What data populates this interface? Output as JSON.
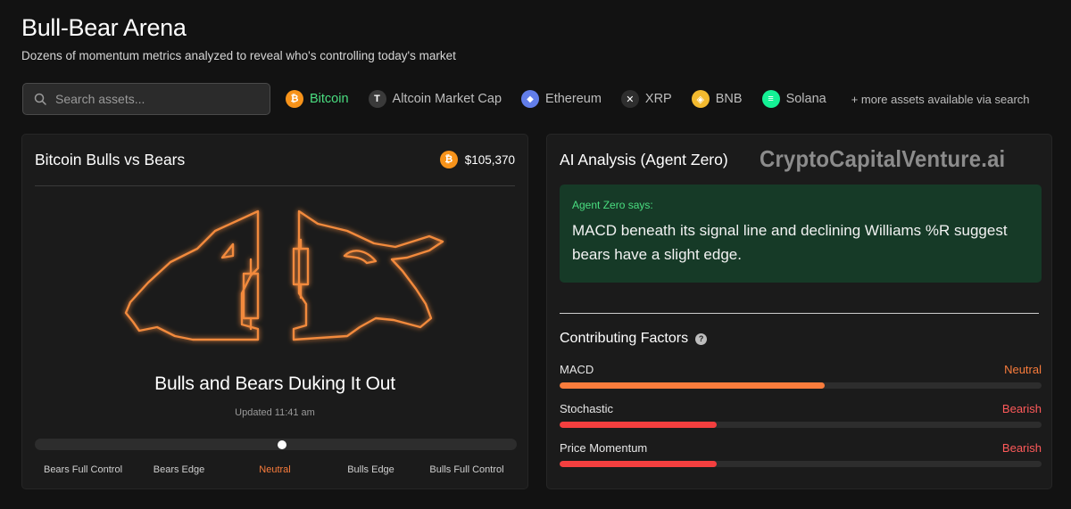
{
  "page": {
    "title": "Bull-Bear Arena",
    "subtitle": "Dozens of momentum metrics analyzed to reveal who's controlling today's market"
  },
  "search": {
    "placeholder": "Search assets..."
  },
  "assets": [
    {
      "label": "Bitcoin",
      "icon": "bitcoin-icon",
      "color": "#f7931a",
      "glyph": "₿",
      "active": true
    },
    {
      "label": "Altcoin Market Cap",
      "icon": "altcoin-icon",
      "color": "#3a3a3a",
      "glyph": "T",
      "active": false
    },
    {
      "label": "Ethereum",
      "icon": "ethereum-icon",
      "color": "#627eea",
      "glyph": "◆",
      "active": false
    },
    {
      "label": "XRP",
      "icon": "xrp-icon",
      "color": "#2e2e2e",
      "glyph": "✕",
      "active": false
    },
    {
      "label": "BNB",
      "icon": "bnb-icon",
      "color": "#f3ba2f",
      "glyph": "◈",
      "active": false
    },
    {
      "label": "Solana",
      "icon": "solana-icon",
      "color": "#14f195",
      "glyph": "≡",
      "active": false
    }
  ],
  "more_assets": "+ more assets available via search",
  "left_card": {
    "title": "Bitcoin Bulls vs Bears",
    "price": "$105,370",
    "verdict": "Bulls and Bears Duking It Out",
    "updated": "Updated 11:41 am",
    "sentiment_position": 0.5,
    "scale_labels": [
      "Bears Full Control",
      "Bears Edge",
      "Neutral",
      "Bulls Edge",
      "Bulls Full Control"
    ],
    "active_scale_index": 2
  },
  "right_card": {
    "title": "AI Analysis (Agent Zero)",
    "watermark": "CryptoCapitalVenture.ai",
    "agent_label": "Agent Zero says:",
    "agent_text": "MACD beneath its signal line and declining Williams %R suggest bears have a slight edge.",
    "factors_title": "Contributing Factors",
    "factors": [
      {
        "name": "MACD",
        "status": "Neutral",
        "level": 0.55,
        "color": "#f97c3c"
      },
      {
        "name": "Stochastic",
        "status": "Bearish",
        "level": 0.325,
        "color": "#f43f3f"
      },
      {
        "name": "Price Momentum",
        "status": "Bearish",
        "level": 0.325,
        "color": "#f43f3f"
      }
    ]
  },
  "colors": {
    "accent_green": "#4ade80",
    "neon_orange": "#f97c3c",
    "bearish_red": "#ff5a5a"
  }
}
